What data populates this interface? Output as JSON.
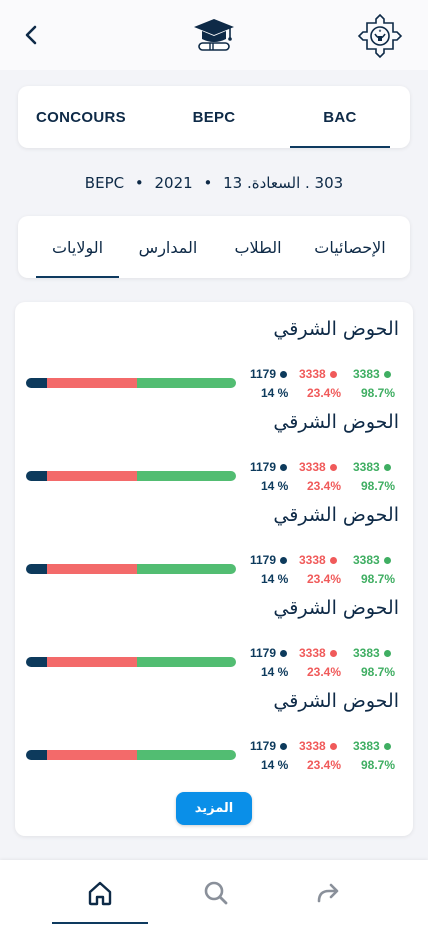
{
  "header": {
    "back_icon": "chevron-left-icon",
    "center_icon": "graduation-cap-icon",
    "right_icon": "national-emblem-icon"
  },
  "exam_tabs": [
    {
      "label": "CONCOURS",
      "active": false
    },
    {
      "label": "BEPC",
      "active": false
    },
    {
      "label": "BAC",
      "active": true
    }
  ],
  "subtitle": {
    "year": "2021",
    "exam": "BEPC",
    "number": "13",
    "location": "303 . السعادة."
  },
  "section_tabs": [
    {
      "label": "الولايات",
      "active": true
    },
    {
      "label": "المدارس",
      "active": false
    },
    {
      "label": "الطلاب",
      "active": false
    },
    {
      "label": "الإحصائيات",
      "active": false
    }
  ],
  "regions": [
    {
      "name": "الحوض الشرقي",
      "green_count": "3383",
      "red_count": "3338",
      "dark_count": "1179",
      "green_pct": "98.7%",
      "red_pct": "23.4%",
      "dark_pct": "14 %"
    },
    {
      "name": "الحوض الشرقي",
      "green_count": "3383",
      "red_count": "3338",
      "dark_count": "1179",
      "green_pct": "98.7%",
      "red_pct": "23.4%",
      "dark_pct": "14 %"
    },
    {
      "name": "الحوض الشرقي",
      "green_count": "3383",
      "red_count": "3338",
      "dark_count": "1179",
      "green_pct": "98.7%",
      "red_pct": "23.4%",
      "dark_pct": "14 %"
    },
    {
      "name": "الحوض الشرقي",
      "green_count": "3383",
      "red_count": "3338",
      "dark_count": "1179",
      "green_pct": "98.7%",
      "red_pct": "23.4%",
      "dark_pct": "14 %"
    },
    {
      "name": "الحوض الشرقي",
      "green_count": "3383",
      "red_count": "3338",
      "dark_count": "1179",
      "green_pct": "98.7%",
      "red_pct": "23.4%",
      "dark_pct": "14 %"
    }
  ],
  "bar_fractions": {
    "dark": 0.1,
    "red": 0.43,
    "green": 0.47
  },
  "more_button": "المزيد",
  "bottom_nav": [
    {
      "icon": "home-icon",
      "active": true
    },
    {
      "icon": "search-icon",
      "active": false
    },
    {
      "icon": "share-icon",
      "active": false
    }
  ],
  "colors": {
    "primary": "#0e3a5f",
    "green": "#3fae62",
    "red": "#f05a5a",
    "accent": "#0a8fe8"
  }
}
